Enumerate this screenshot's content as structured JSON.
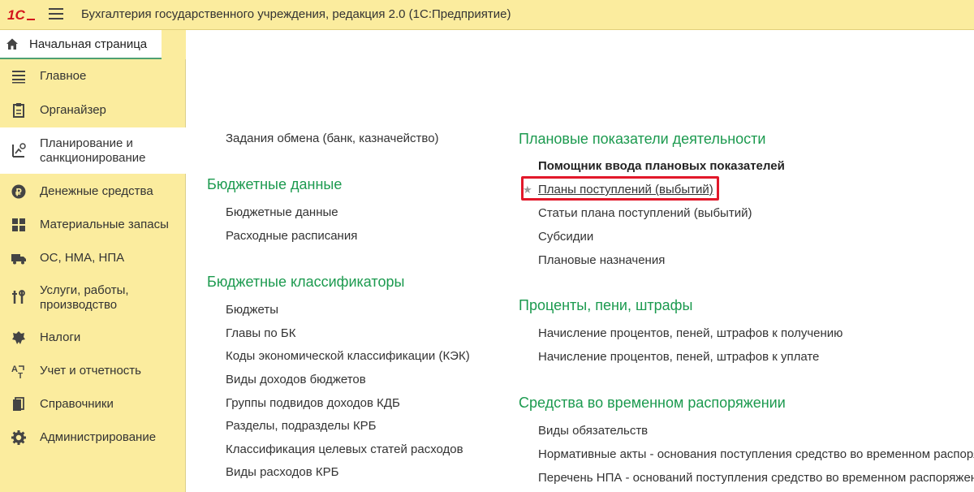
{
  "window": {
    "title": "Бухгалтерия государственного учреждения, редакция 2.0  (1С:Предприятие)",
    "logo_icon": "1c-logo-icon",
    "menu_icon": "hamburger-menu-icon"
  },
  "home_tab": {
    "label": "Начальная страница",
    "icon": "home-icon"
  },
  "sidebar": {
    "items": [
      {
        "label": "Главное",
        "icon": "list-icon",
        "active": false
      },
      {
        "label": "Органайзер",
        "icon": "clipboard-icon",
        "active": false
      },
      {
        "label": "Планирование и\nсанкционирование",
        "icon": "planning-icon",
        "active": true
      },
      {
        "label": "Денежные средства",
        "icon": "ruble-coin-icon",
        "active": false
      },
      {
        "label": "Материальные запасы",
        "icon": "grid-icon",
        "active": false
      },
      {
        "label": "ОС, НМА, НПА",
        "icon": "truck-icon",
        "active": false
      },
      {
        "label": "Услуги, работы,\nпроизводство",
        "icon": "tools-icon",
        "active": false
      },
      {
        "label": "Налоги",
        "icon": "emblem-icon",
        "active": false
      },
      {
        "label": "Учет и отчетность",
        "icon": "translate-icon",
        "active": false
      },
      {
        "label": "Справочники",
        "icon": "books-icon",
        "active": false
      },
      {
        "label": "Администрирование",
        "icon": "gear-icon",
        "active": false
      }
    ]
  },
  "content": {
    "left": {
      "top_link": "Задания обмена (банк, казначейство)",
      "sections": [
        {
          "title": "Бюджетные данные",
          "links": [
            "Бюджетные данные",
            "Расходные расписания"
          ]
        },
        {
          "title": "Бюджетные классификаторы",
          "links": [
            "Бюджеты",
            "Главы по БК",
            "Коды экономической классификации (КЭК)",
            "Виды доходов бюджетов",
            "Группы подвидов доходов КДБ",
            "Разделы, подразделы КРБ",
            "Классификация целевых статей расходов",
            "Виды расходов КРБ"
          ]
        }
      ]
    },
    "right": {
      "sections": [
        {
          "title": "Плановые показатели деятельности",
          "links": [
            "Помощник ввода плановых показателей",
            "Планы поступлений (выбытий)",
            "Статьи плана поступлений (выбытий)",
            "Субсидии",
            "Плановые назначения"
          ]
        },
        {
          "title": "Проценты, пени, штрафы",
          "links": [
            "Начисление процентов, пеней, штрафов к получению",
            "Начисление процентов, пеней, штрафов к уплате"
          ]
        },
        {
          "title": "Средства во временном распоряжении",
          "links": [
            "Виды обязательств",
            "Нормативные акты - основания  поступления средство во временном распоряжении",
            "Перечень НПА - оснований поступления средство во временном распоряжении"
          ]
        }
      ]
    },
    "favorite_icon": "star-icon"
  },
  "colors": {
    "accent_green": "#1c9a4f",
    "panel_yellow": "#fbec9e",
    "highlight_red": "#e2182a"
  }
}
